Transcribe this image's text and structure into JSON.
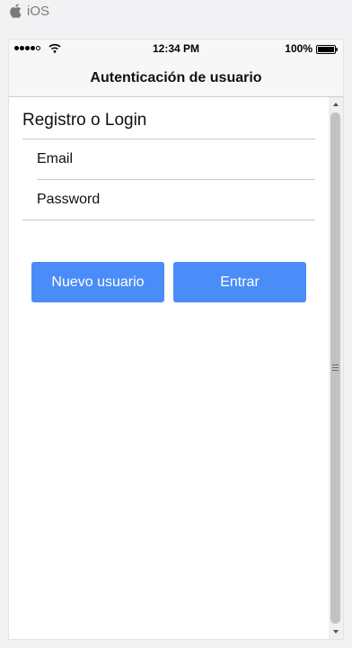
{
  "platform": {
    "icon": "apple-icon",
    "label": "iOS"
  },
  "status_bar": {
    "time": "12:34 PM",
    "battery_percent": "100%",
    "signal_icon": "cellular-signal-icon",
    "wifi_icon": "wifi-icon",
    "battery_icon": "battery-icon"
  },
  "nav": {
    "title": "Autenticación de usuario"
  },
  "form": {
    "section_header": "Registro o Login",
    "fields": [
      {
        "label": "Email"
      },
      {
        "label": "Password"
      }
    ]
  },
  "buttons": {
    "new_user": "Nuevo usuario",
    "login": "Entrar"
  },
  "colors": {
    "accent": "#4a8df8",
    "background": "#f2f2f4"
  }
}
